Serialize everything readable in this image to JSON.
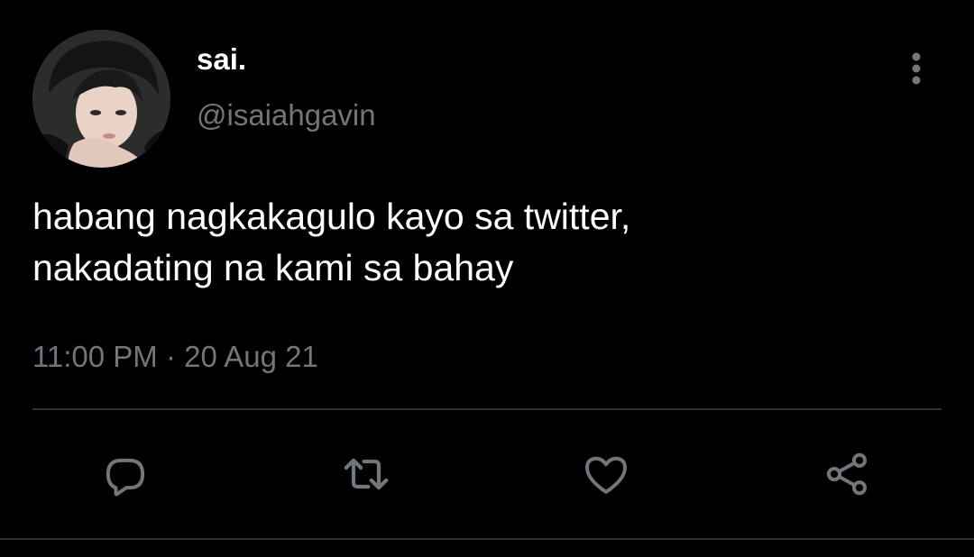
{
  "author": {
    "display_name": "sai.",
    "handle": "@isaiahgavin",
    "avatar_icon": "profile-photo"
  },
  "tweet": {
    "text_lines": [
      "habang nagkakagulo kayo sa twitter,",
      "nakadating na kami sa bahay"
    ],
    "time": "11:00 PM",
    "separator": "·",
    "date": "20 Aug 21"
  },
  "actions": [
    {
      "name": "reply",
      "icon": "comment-icon"
    },
    {
      "name": "retweet",
      "icon": "retweet-icon"
    },
    {
      "name": "like",
      "icon": "heart-icon"
    },
    {
      "name": "share",
      "icon": "share-icon"
    }
  ],
  "colors": {
    "background": "#000000",
    "primary_text": "#ffffff",
    "secondary_text": "#71767b",
    "divider": "#2f3336"
  }
}
